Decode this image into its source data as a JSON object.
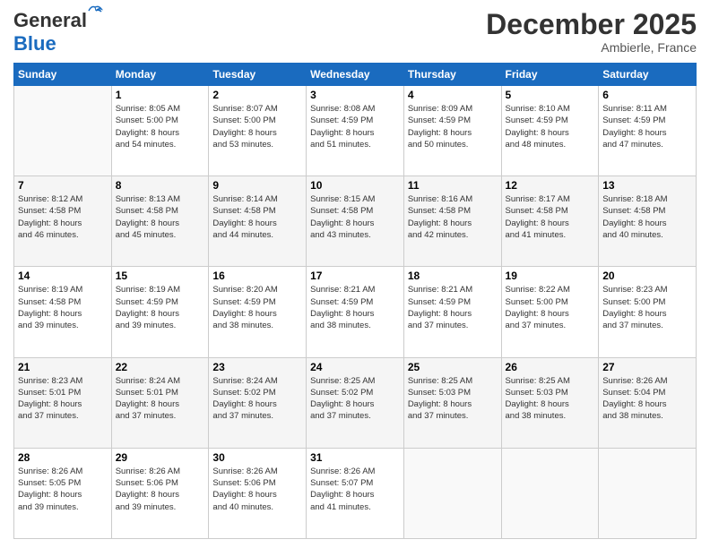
{
  "logo": {
    "line1": "General",
    "line2": "Blue"
  },
  "title": "December 2025",
  "location": "Ambierle, France",
  "weekdays": [
    "Sunday",
    "Monday",
    "Tuesday",
    "Wednesday",
    "Thursday",
    "Friday",
    "Saturday"
  ],
  "weeks": [
    [
      {
        "day": "",
        "info": ""
      },
      {
        "day": "1",
        "info": "Sunrise: 8:05 AM\nSunset: 5:00 PM\nDaylight: 8 hours\nand 54 minutes."
      },
      {
        "day": "2",
        "info": "Sunrise: 8:07 AM\nSunset: 5:00 PM\nDaylight: 8 hours\nand 53 minutes."
      },
      {
        "day": "3",
        "info": "Sunrise: 8:08 AM\nSunset: 4:59 PM\nDaylight: 8 hours\nand 51 minutes."
      },
      {
        "day": "4",
        "info": "Sunrise: 8:09 AM\nSunset: 4:59 PM\nDaylight: 8 hours\nand 50 minutes."
      },
      {
        "day": "5",
        "info": "Sunrise: 8:10 AM\nSunset: 4:59 PM\nDaylight: 8 hours\nand 48 minutes."
      },
      {
        "day": "6",
        "info": "Sunrise: 8:11 AM\nSunset: 4:59 PM\nDaylight: 8 hours\nand 47 minutes."
      }
    ],
    [
      {
        "day": "7",
        "info": "Sunrise: 8:12 AM\nSunset: 4:58 PM\nDaylight: 8 hours\nand 46 minutes."
      },
      {
        "day": "8",
        "info": "Sunrise: 8:13 AM\nSunset: 4:58 PM\nDaylight: 8 hours\nand 45 minutes."
      },
      {
        "day": "9",
        "info": "Sunrise: 8:14 AM\nSunset: 4:58 PM\nDaylight: 8 hours\nand 44 minutes."
      },
      {
        "day": "10",
        "info": "Sunrise: 8:15 AM\nSunset: 4:58 PM\nDaylight: 8 hours\nand 43 minutes."
      },
      {
        "day": "11",
        "info": "Sunrise: 8:16 AM\nSunset: 4:58 PM\nDaylight: 8 hours\nand 42 minutes."
      },
      {
        "day": "12",
        "info": "Sunrise: 8:17 AM\nSunset: 4:58 PM\nDaylight: 8 hours\nand 41 minutes."
      },
      {
        "day": "13",
        "info": "Sunrise: 8:18 AM\nSunset: 4:58 PM\nDaylight: 8 hours\nand 40 minutes."
      }
    ],
    [
      {
        "day": "14",
        "info": "Sunrise: 8:19 AM\nSunset: 4:58 PM\nDaylight: 8 hours\nand 39 minutes."
      },
      {
        "day": "15",
        "info": "Sunrise: 8:19 AM\nSunset: 4:59 PM\nDaylight: 8 hours\nand 39 minutes."
      },
      {
        "day": "16",
        "info": "Sunrise: 8:20 AM\nSunset: 4:59 PM\nDaylight: 8 hours\nand 38 minutes."
      },
      {
        "day": "17",
        "info": "Sunrise: 8:21 AM\nSunset: 4:59 PM\nDaylight: 8 hours\nand 38 minutes."
      },
      {
        "day": "18",
        "info": "Sunrise: 8:21 AM\nSunset: 4:59 PM\nDaylight: 8 hours\nand 37 minutes."
      },
      {
        "day": "19",
        "info": "Sunrise: 8:22 AM\nSunset: 5:00 PM\nDaylight: 8 hours\nand 37 minutes."
      },
      {
        "day": "20",
        "info": "Sunrise: 8:23 AM\nSunset: 5:00 PM\nDaylight: 8 hours\nand 37 minutes."
      }
    ],
    [
      {
        "day": "21",
        "info": "Sunrise: 8:23 AM\nSunset: 5:01 PM\nDaylight: 8 hours\nand 37 minutes."
      },
      {
        "day": "22",
        "info": "Sunrise: 8:24 AM\nSunset: 5:01 PM\nDaylight: 8 hours\nand 37 minutes."
      },
      {
        "day": "23",
        "info": "Sunrise: 8:24 AM\nSunset: 5:02 PM\nDaylight: 8 hours\nand 37 minutes."
      },
      {
        "day": "24",
        "info": "Sunrise: 8:25 AM\nSunset: 5:02 PM\nDaylight: 8 hours\nand 37 minutes."
      },
      {
        "day": "25",
        "info": "Sunrise: 8:25 AM\nSunset: 5:03 PM\nDaylight: 8 hours\nand 37 minutes."
      },
      {
        "day": "26",
        "info": "Sunrise: 8:25 AM\nSunset: 5:03 PM\nDaylight: 8 hours\nand 38 minutes."
      },
      {
        "day": "27",
        "info": "Sunrise: 8:26 AM\nSunset: 5:04 PM\nDaylight: 8 hours\nand 38 minutes."
      }
    ],
    [
      {
        "day": "28",
        "info": "Sunrise: 8:26 AM\nSunset: 5:05 PM\nDaylight: 8 hours\nand 39 minutes."
      },
      {
        "day": "29",
        "info": "Sunrise: 8:26 AM\nSunset: 5:06 PM\nDaylight: 8 hours\nand 39 minutes."
      },
      {
        "day": "30",
        "info": "Sunrise: 8:26 AM\nSunset: 5:06 PM\nDaylight: 8 hours\nand 40 minutes."
      },
      {
        "day": "31",
        "info": "Sunrise: 8:26 AM\nSunset: 5:07 PM\nDaylight: 8 hours\nand 41 minutes."
      },
      {
        "day": "",
        "info": ""
      },
      {
        "day": "",
        "info": ""
      },
      {
        "day": "",
        "info": ""
      }
    ]
  ]
}
